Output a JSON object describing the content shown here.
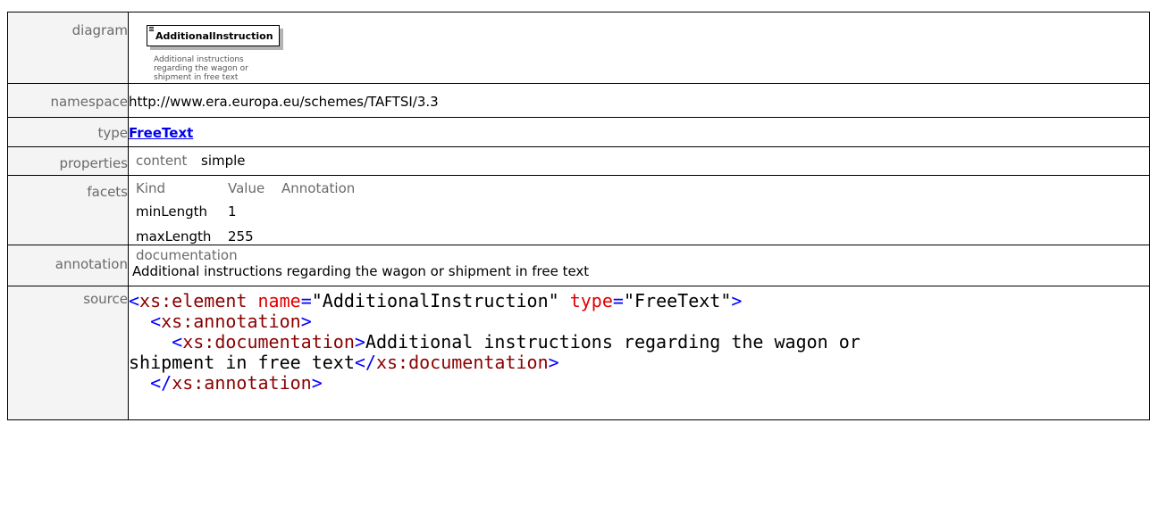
{
  "labels": {
    "diagram": "diagram",
    "namespace": "namespace",
    "type": "type",
    "properties": "properties",
    "facets": "facets",
    "annotation": "annotation",
    "source": "source"
  },
  "diagram": {
    "element_name": "AdditionalInstruction",
    "note_lines": [
      "Additional instructions",
      "regarding the wagon or",
      "shipment in free text"
    ]
  },
  "namespace": "http://www.era.europa.eu/schemes/TAFTSI/3.3",
  "type": "FreeText",
  "properties": {
    "key": "content",
    "value": "simple"
  },
  "facets": {
    "headers": [
      "Kind",
      "Value",
      "Annotation"
    ],
    "rows": [
      {
        "kind": "minLength",
        "value": "1"
      },
      {
        "kind": "maxLength",
        "value": "255"
      }
    ]
  },
  "annotation": {
    "heading": "documentation",
    "text": "Additional instructions regarding the wagon or shipment in free text"
  },
  "source": {
    "l1_open": "<",
    "l1_tag": "xs:element",
    "l1_attr1": " name",
    "l1_eq1": "=",
    "l1_val1": "\"AdditionalInstruction\"",
    "l1_attr2": " type",
    "l1_eq2": "=",
    "l1_val2": "\"FreeText\"",
    "l1_close": ">",
    "l2_open": "<",
    "l2_tag": "xs:annotation",
    "l2_close": ">",
    "l3_open": "<",
    "l3_tag": "xs:documentation",
    "l3_close": ">",
    "l3_text": "Additional instructions regarding the wagon or",
    "l4_text": "shipment in free text",
    "l4_open": "</",
    "l4_tag": "xs:documentation",
    "l4_close": ">",
    "l5_open": "</",
    "l5_tag": "xs:annotation",
    "l5_close": ">"
  }
}
